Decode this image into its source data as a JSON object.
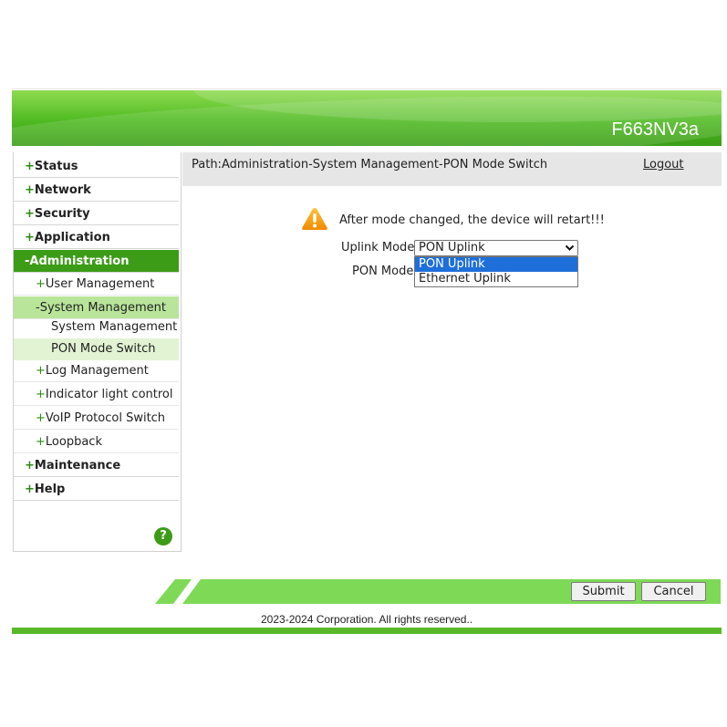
{
  "header": {
    "model": "F663NV3a"
  },
  "sidebar": {
    "items": [
      {
        "sign": "+",
        "label": "Status"
      },
      {
        "sign": "+",
        "label": "Network"
      },
      {
        "sign": "+",
        "label": "Security"
      },
      {
        "sign": "+",
        "label": "Application"
      },
      {
        "sign": "-",
        "label": "Administration"
      },
      {
        "sign": "+",
        "label": "User Management"
      },
      {
        "sign": "-",
        "label": "System Management"
      },
      {
        "label": "System Management"
      },
      {
        "label": "PON Mode Switch"
      },
      {
        "sign": "+",
        "label": "Log Management"
      },
      {
        "sign": "+",
        "label": "Indicator light control"
      },
      {
        "sign": "+",
        "label": "VoIP Protocol Switch"
      },
      {
        "sign": "+",
        "label": "Loopback"
      },
      {
        "sign": "+",
        "label": "Maintenance"
      },
      {
        "sign": "+",
        "label": "Help"
      }
    ],
    "help_glyph": "?"
  },
  "pathbar": {
    "path": "Path:Administration-System Management-PON Mode Switch",
    "logout": "Logout"
  },
  "main": {
    "warning": "After mode changed, the device will retart!!!",
    "uplink_label": "Uplink Mode",
    "uplink_value": "PON Uplink",
    "pon_label": "PON Mode",
    "dropdown_options": [
      "PON Uplink",
      "Ethernet Uplink"
    ]
  },
  "buttons": {
    "submit": "Submit",
    "cancel": "Cancel"
  },
  "footer": {
    "copyright": "2023-2024 Corporation. All rights reserved.."
  },
  "colors": {
    "brand_green": "#3c9c17",
    "highlight_blue": "#1e6fd9"
  },
  "icons": {
    "warning": "warning-triangle-icon",
    "help": "help-icon",
    "chevron": "chevron-down-icon"
  }
}
